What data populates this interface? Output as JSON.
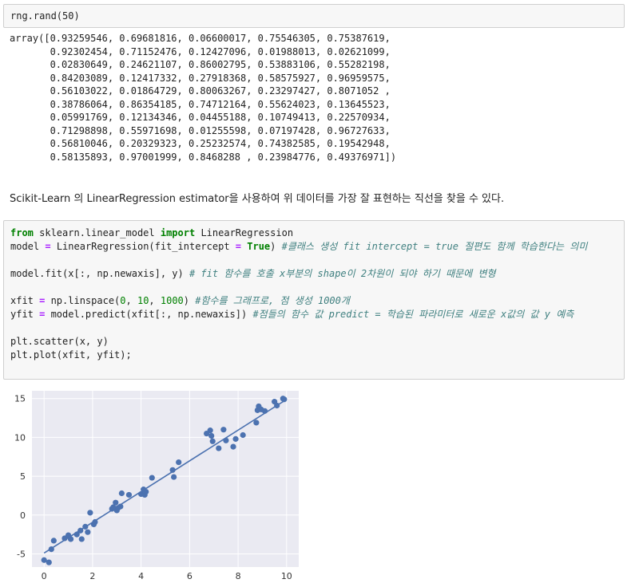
{
  "cell1": {
    "code": "rng.rand(50)",
    "output": "array([0.93259546, 0.69681816, 0.06600017, 0.75546305, 0.75387619,\n       0.92302454, 0.71152476, 0.12427096, 0.01988013, 0.02621099,\n       0.02830649, 0.24621107, 0.86002795, 0.53883106, 0.55282198,\n       0.84203089, 0.12417332, 0.27918368, 0.58575927, 0.96959575,\n       0.56103022, 0.01864729, 0.80063267, 0.23297427, 0.8071052 ,\n       0.38786064, 0.86354185, 0.74712164, 0.55624023, 0.13645523,\n       0.05991769, 0.12134346, 0.04455188, 0.10749413, 0.22570934,\n       0.71298898, 0.55971698, 0.01255598, 0.07197428, 0.96727633,\n       0.56810046, 0.20329323, 0.25232574, 0.74382585, 0.19542948,\n       0.58135893, 0.97001999, 0.8468288 , 0.23984776, 0.49376971])"
  },
  "markdown": {
    "text": "Scikit-Learn 의 LinearRegression estimator을 사용하여 위 데이터를 가장 잘 표현하는 직선을 찾을 수 있다."
  },
  "cell2": {
    "lines": [
      [
        {
          "t": "from",
          "c": "kw"
        },
        {
          "t": " sklearn.linear_model ",
          "c": "plain"
        },
        {
          "t": "import",
          "c": "kw"
        },
        {
          "t": " LinearRegression",
          "c": "plain"
        }
      ],
      [
        {
          "t": "model ",
          "c": "plain"
        },
        {
          "t": "=",
          "c": "op"
        },
        {
          "t": " LinearRegression(fit_intercept ",
          "c": "plain"
        },
        {
          "t": "=",
          "c": "op"
        },
        {
          "t": " ",
          "c": "plain"
        },
        {
          "t": "True",
          "c": "kw"
        },
        {
          "t": ") ",
          "c": "plain"
        },
        {
          "t": "#클래스 생성 fit intercept = true 절편도 함께 학습한다는 의미",
          "c": "cm"
        }
      ],
      [],
      [
        {
          "t": "model.fit(x[:, np.newaxis], y) ",
          "c": "plain"
        },
        {
          "t": "# fit 함수를 호출 x부분의 shape이 2차원이 되야 하기 때문에 변형",
          "c": "cm"
        }
      ],
      [],
      [
        {
          "t": "xfit ",
          "c": "plain"
        },
        {
          "t": "=",
          "c": "op"
        },
        {
          "t": " np.linspace(",
          "c": "plain"
        },
        {
          "t": "0",
          "c": "num"
        },
        {
          "t": ", ",
          "c": "plain"
        },
        {
          "t": "10",
          "c": "num"
        },
        {
          "t": ", ",
          "c": "plain"
        },
        {
          "t": "1000",
          "c": "num"
        },
        {
          "t": ") ",
          "c": "plain"
        },
        {
          "t": "#함수를 그래프로, 점 생성 1000개",
          "c": "cm"
        }
      ],
      [
        {
          "t": "yfit ",
          "c": "plain"
        },
        {
          "t": "=",
          "c": "op"
        },
        {
          "t": " model.predict(xfit[:, np.newaxis]) ",
          "c": "plain"
        },
        {
          "t": "#점들의 함수 값 predict = 학습된 파라미터로 새로운 x값의 값 y 예측",
          "c": "cm"
        }
      ],
      [],
      [
        {
          "t": "plt.scatter(x, y)",
          "c": "plain"
        }
      ],
      [
        {
          "t": "plt.plot(xfit, yfit);",
          "c": "plain"
        }
      ]
    ]
  },
  "chart_data": {
    "type": "scatter",
    "xlim": [
      -0.5,
      10.5
    ],
    "ylim": [
      -6.7,
      16
    ],
    "xticks": [
      "0",
      "2",
      "4",
      "6",
      "8",
      "10"
    ],
    "yticks": [
      "-5",
      "0",
      "5",
      "10",
      "15"
    ],
    "points": [
      [
        0.0,
        -5.8
      ],
      [
        0.2,
        -6.1
      ],
      [
        0.3,
        -4.4
      ],
      [
        0.4,
        -3.3
      ],
      [
        0.85,
        -3.0
      ],
      [
        1.0,
        -2.6
      ],
      [
        1.1,
        -3.1
      ],
      [
        1.35,
        -2.5
      ],
      [
        1.5,
        -2.0
      ],
      [
        1.55,
        -3.1
      ],
      [
        1.7,
        -1.5
      ],
      [
        1.8,
        -2.2
      ],
      [
        1.9,
        0.3
      ],
      [
        2.05,
        -1.2
      ],
      [
        2.1,
        -0.9
      ],
      [
        2.8,
        0.8
      ],
      [
        2.85,
        1.0
      ],
      [
        2.95,
        1.6
      ],
      [
        3.0,
        0.6
      ],
      [
        3.05,
        0.9
      ],
      [
        3.15,
        1.1
      ],
      [
        3.2,
        2.8
      ],
      [
        3.5,
        2.6
      ],
      [
        4.0,
        2.7
      ],
      [
        4.1,
        3.3
      ],
      [
        4.15,
        2.6
      ],
      [
        4.2,
        3.0
      ],
      [
        4.45,
        4.8
      ],
      [
        5.3,
        5.8
      ],
      [
        5.35,
        4.9
      ],
      [
        5.55,
        6.8
      ],
      [
        6.7,
        10.5
      ],
      [
        6.85,
        10.9
      ],
      [
        6.9,
        10.2
      ],
      [
        6.95,
        9.5
      ],
      [
        7.2,
        8.6
      ],
      [
        7.4,
        11.0
      ],
      [
        7.5,
        9.6
      ],
      [
        7.8,
        8.8
      ],
      [
        7.9,
        9.8
      ],
      [
        8.2,
        10.3
      ],
      [
        8.75,
        11.9
      ],
      [
        8.8,
        13.5
      ],
      [
        8.85,
        14.0
      ],
      [
        8.95,
        13.6
      ],
      [
        9.1,
        13.4
      ],
      [
        9.5,
        14.6
      ],
      [
        9.6,
        14.1
      ],
      [
        9.85,
        15.0
      ],
      [
        9.9,
        14.9
      ]
    ],
    "line": {
      "x": [
        0.0,
        9.9
      ],
      "y": [
        -4.9,
        14.7
      ]
    },
    "point_color": "#4c72b0",
    "line_color": "#4c72b0",
    "bg_color": "#eaeaf2",
    "grid": true
  }
}
